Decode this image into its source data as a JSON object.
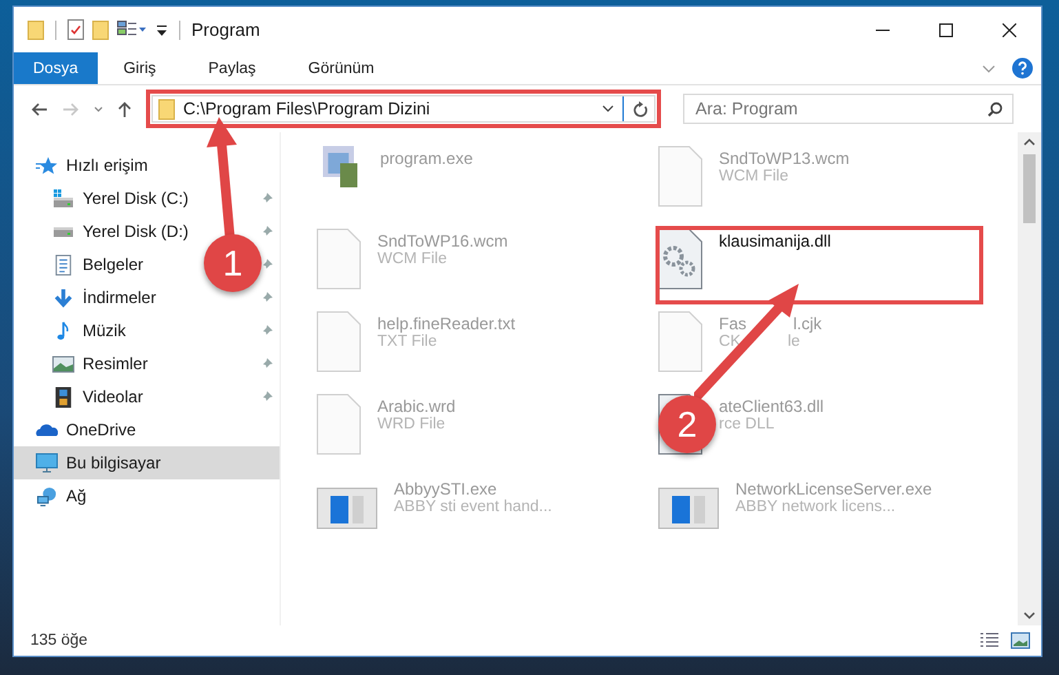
{
  "window": {
    "title": "Program"
  },
  "ribbon": {
    "tabs": [
      {
        "label": "Dosya",
        "selected": true
      },
      {
        "label": "Giriş",
        "selected": false
      },
      {
        "label": "Paylaş",
        "selected": false
      },
      {
        "label": "Görünüm",
        "selected": false
      }
    ]
  },
  "address": {
    "path": "C:\\Program Files\\Program Dizini",
    "search_placeholder": "Ara: Program"
  },
  "sidebar": {
    "items": [
      {
        "label": "Hızlı erişim",
        "kind": "star",
        "selected": false,
        "children": [
          {
            "label": "Yerel Disk (C:)",
            "kind": "drive-win",
            "pinned": true,
            "selected": false
          },
          {
            "label": "Yerel Disk (D:)",
            "kind": "drive",
            "pinned": true,
            "selected": false
          },
          {
            "label": "Belgeler",
            "kind": "doc",
            "pinned": true,
            "selected": false
          },
          {
            "label": "İndirmeler",
            "kind": "down",
            "pinned": true,
            "selected": false
          },
          {
            "label": "Müzik",
            "kind": "music",
            "pinned": true,
            "selected": false
          },
          {
            "label": "Resimler",
            "kind": "image",
            "pinned": true,
            "selected": false
          },
          {
            "label": "Videolar",
            "kind": "film",
            "pinned": true,
            "selected": false
          }
        ]
      },
      {
        "label": "OneDrive",
        "kind": "cloud",
        "selected": false
      },
      {
        "label": "Bu bilgisayar",
        "kind": "monitor",
        "selected": true
      },
      {
        "label": "Ağ",
        "kind": "network",
        "selected": false
      }
    ]
  },
  "files": [
    {
      "name_parts": [
        "program.exe"
      ],
      "kind": "app",
      "highlighted": false
    },
    {
      "name_parts": [
        "SndToWP13.wcm"
      ],
      "type_parts": [
        "WCM File"
      ],
      "kind": "blank",
      "highlighted": false
    },
    {
      "name_parts": [
        "SndToWP16.wcm"
      ],
      "type_parts": [
        "WCM File"
      ],
      "kind": "blank",
      "highlighted": false
    },
    {
      "name_parts": [
        "klausimanija.dll"
      ],
      "kind": "gear",
      "highlighted": true
    },
    {
      "name_parts": [
        "help.fineReader.txt"
      ],
      "type_parts": [
        "TXT File"
      ],
      "kind": "blank",
      "highlighted": false
    },
    {
      "name_parts": [
        "Fas",
        "l.cjk"
      ],
      "type_parts": [
        "CK",
        "le"
      ],
      "kind": "blank",
      "highlighted": false
    },
    {
      "name_parts": [
        "Arabic.wrd"
      ],
      "type_parts": [
        "WRD File"
      ],
      "kind": "blank",
      "highlighted": false
    },
    {
      "name_parts": [
        "ateClient63.dll"
      ],
      "type_parts": [
        "rce DLL"
      ],
      "kind": "gear",
      "highlighted": false
    },
    {
      "name_parts": [
        "AbbyySTI.exe"
      ],
      "type_parts": [
        "ABBY sti event hand..."
      ],
      "kind": "wide",
      "highlighted": false
    },
    {
      "name_parts": [
        "NetworkLicenseServer.exe"
      ],
      "type_parts": [
        "ABBY network licens..."
      ],
      "kind": "wide",
      "highlighted": false
    }
  ],
  "status_bar": {
    "count": "135 öğe"
  },
  "annotations": [
    {
      "number": "1"
    },
    {
      "number": "2"
    }
  ]
}
